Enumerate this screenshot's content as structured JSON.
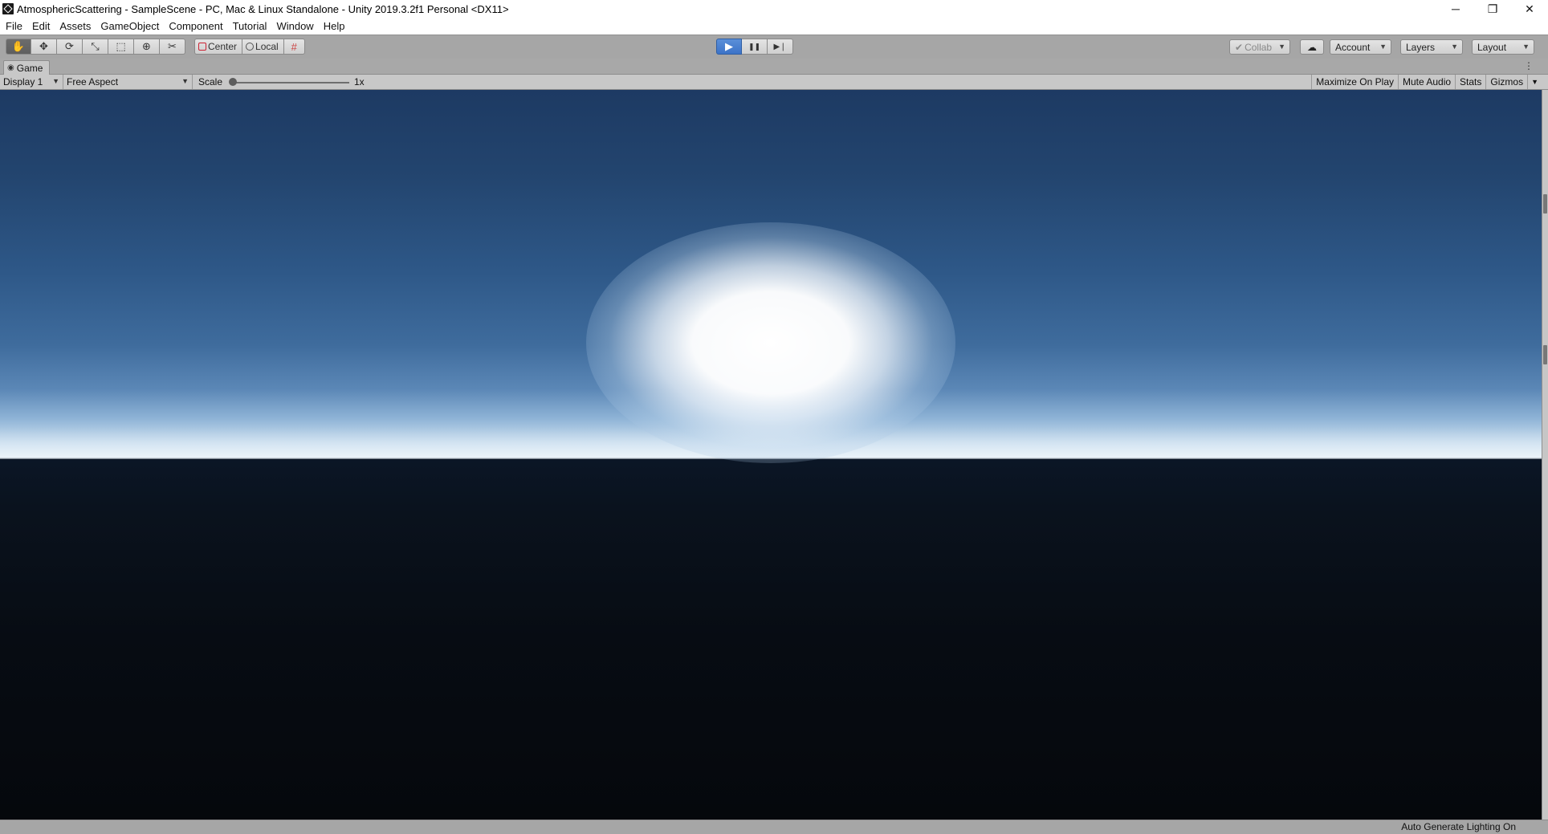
{
  "window": {
    "title": "AtmosphericScattering - SampleScene - PC, Mac & Linux Standalone - Unity 2019.3.2f1 Personal <DX11>",
    "controls": {
      "minimize": "─",
      "restore": "❐",
      "close": "✕"
    }
  },
  "menu": [
    "File",
    "Edit",
    "Assets",
    "GameObject",
    "Component",
    "Tutorial",
    "Window",
    "Help"
  ],
  "toolbar": {
    "transform_tools": [
      {
        "name": "hand-tool",
        "glyph": "✋",
        "active": true
      },
      {
        "name": "move-tool",
        "glyph": "✥",
        "active": false
      },
      {
        "name": "rotate-tool",
        "glyph": "⟳",
        "active": false
      },
      {
        "name": "scale-tool",
        "glyph": "⤡",
        "active": false
      },
      {
        "name": "rect-tool",
        "glyph": "⬚",
        "active": false
      },
      {
        "name": "transform-tool",
        "glyph": "⊕",
        "active": false
      },
      {
        "name": "custom-tool",
        "glyph": "✂",
        "active": false
      }
    ],
    "pivot_mode": "Center",
    "pivot_rotation": "Local",
    "play_controls": {
      "play": "▶",
      "pause": "❚❚",
      "step": "▶❘"
    },
    "collab_label": "Collab",
    "cloud_glyph": "☁",
    "account_label": "Account",
    "layers_label": "Layers",
    "layout_label": "Layout"
  },
  "game_tab": {
    "label": "Game",
    "icon": "gamepad-icon"
  },
  "game_toolbar": {
    "display": "Display 1",
    "aspect": "Free Aspect",
    "scale_label": "Scale",
    "scale_value": "1x",
    "buttons": [
      "Maximize On Play",
      "Mute Audio",
      "Stats",
      "Gizmos"
    ]
  },
  "status": {
    "text": "Auto Generate Lighting On"
  },
  "colors": {
    "sky_top": "#1d3a63",
    "horizon": "#eaf2f9",
    "ground": "#05080c",
    "play_active": "#3c73c8"
  }
}
